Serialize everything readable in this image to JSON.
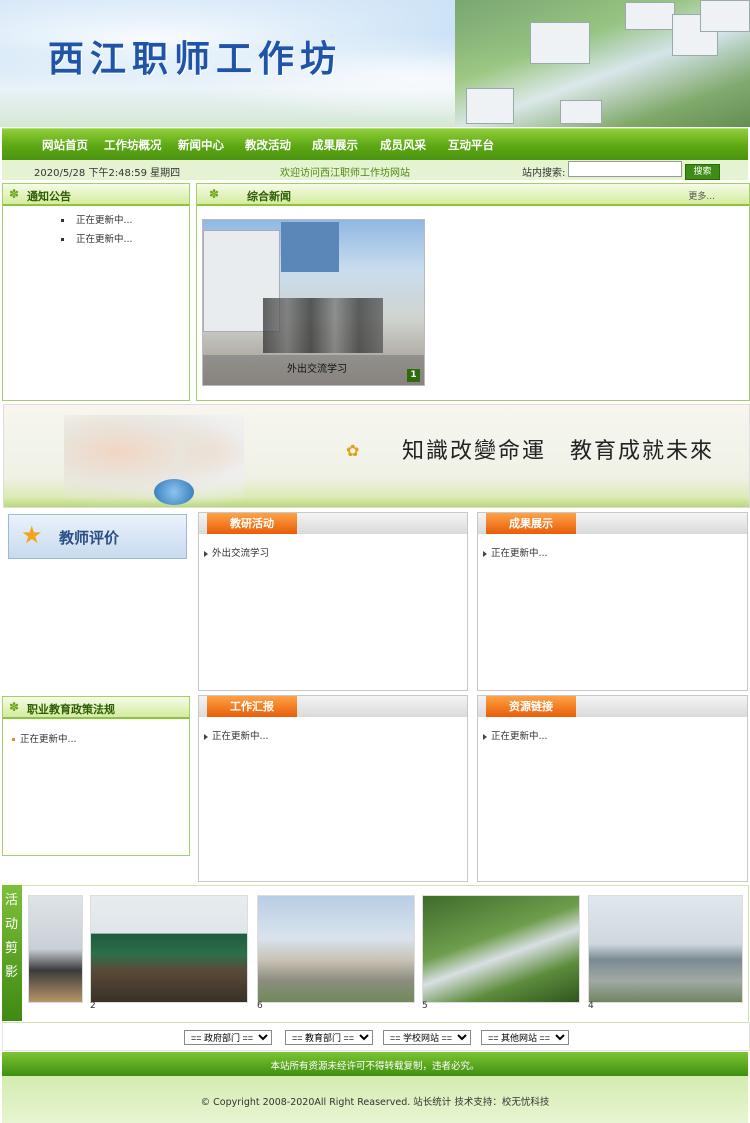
{
  "site": {
    "title": "西江职师工作坊"
  },
  "nav": {
    "items": [
      "网站首页",
      "工作坊概况",
      "新闻中心",
      "教改活动",
      "成果展示",
      "成员风采",
      "互动平台"
    ]
  },
  "infobar": {
    "datetime": "2020/5/28 下午2:48:59 星期四",
    "welcome": "欢迎访问西江职师工作坊网站",
    "search_label": "站内搜索:",
    "search_placeholder": "",
    "search_button": "搜索"
  },
  "notice": {
    "title": "通知公告",
    "items": [
      "正在更新中...",
      "正在更新中..."
    ]
  },
  "news": {
    "title": "综合新闻",
    "more": "更多...",
    "feature_caption": "外出交流学习",
    "page_num": "1"
  },
  "slogan_banner": {
    "text": "知識改變命運　教育成就未來"
  },
  "evaluation": {
    "label": "教师评价"
  },
  "research": {
    "tab": "教研活动",
    "items": [
      "外出交流学习"
    ]
  },
  "results": {
    "tab": "成果展示",
    "items": [
      "正在更新中..."
    ]
  },
  "policy": {
    "title": "职业教育政策法规",
    "items": [
      "正在更新中..."
    ]
  },
  "report": {
    "tab": "工作汇报",
    "items": [
      "正在更新中..."
    ]
  },
  "resources": {
    "tab": "资源链接",
    "items": [
      "正在更新中..."
    ]
  },
  "gallery": {
    "label_chars": [
      "活",
      "动",
      "剪",
      "影"
    ],
    "captions": [
      "",
      "2",
      "6",
      "5",
      "4"
    ]
  },
  "links": {
    "selects": [
      "== 政府部门 ==",
      "== 教育部门 ==",
      "== 学校网站 ==",
      "== 其他网站 =="
    ]
  },
  "footer": {
    "notice": "本站所有资源未经许可不得转载复制，违者必究。",
    "copyright": "© Copyright 2008-2020All Right Reaserved.  站长统计 技术支持：校无忧科技"
  }
}
